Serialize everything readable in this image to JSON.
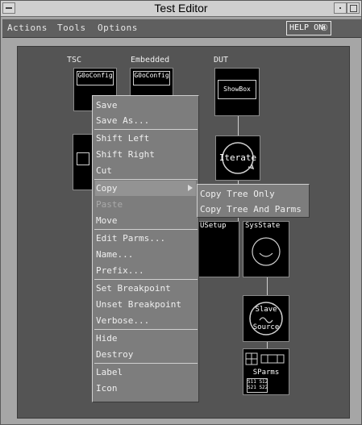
{
  "window": {
    "title": "Test Editor"
  },
  "menubar": {
    "items": [
      {
        "label": "Actions"
      },
      {
        "label": "Tools"
      },
      {
        "label": "Options"
      }
    ],
    "help_label": "HELP ON",
    "help_icon": "question-icon"
  },
  "canvas": {
    "columns": [
      {
        "label": "TSC"
      },
      {
        "label": "Embedded"
      },
      {
        "label": "DUT"
      }
    ],
    "nodes": {
      "tsc_config": "G0oConfig",
      "emb_config": "G0oConfig",
      "showbox": "ShowBox",
      "iterate": "Iterate",
      "setup": "USetup",
      "sysstate": "SysState",
      "slave_top": "Slave",
      "slave_bottom": "Source",
      "sparms": "SParms",
      "sparms_matrix": "S11 S12\nS21 S22"
    }
  },
  "context_menu": {
    "items": [
      {
        "label": "Save"
      },
      {
        "label": "Save As..."
      },
      {
        "label": "Shift Left"
      },
      {
        "label": "Shift Right"
      },
      {
        "label": "Cut"
      },
      {
        "label": "Copy"
      },
      {
        "label": "Paste"
      },
      {
        "label": "Move"
      },
      {
        "label": "Edit Parms..."
      },
      {
        "label": "Name..."
      },
      {
        "label": "Prefix..."
      },
      {
        "label": "Set Breakpoint"
      },
      {
        "label": "Unset Breakpoint"
      },
      {
        "label": "Verbose..."
      },
      {
        "label": "Hide"
      },
      {
        "label": "Destroy"
      },
      {
        "label": "Label"
      },
      {
        "label": "Icon"
      }
    ]
  },
  "submenu": {
    "items": [
      {
        "label": "Copy Tree Only"
      },
      {
        "label": "Copy Tree And Parms"
      }
    ]
  }
}
